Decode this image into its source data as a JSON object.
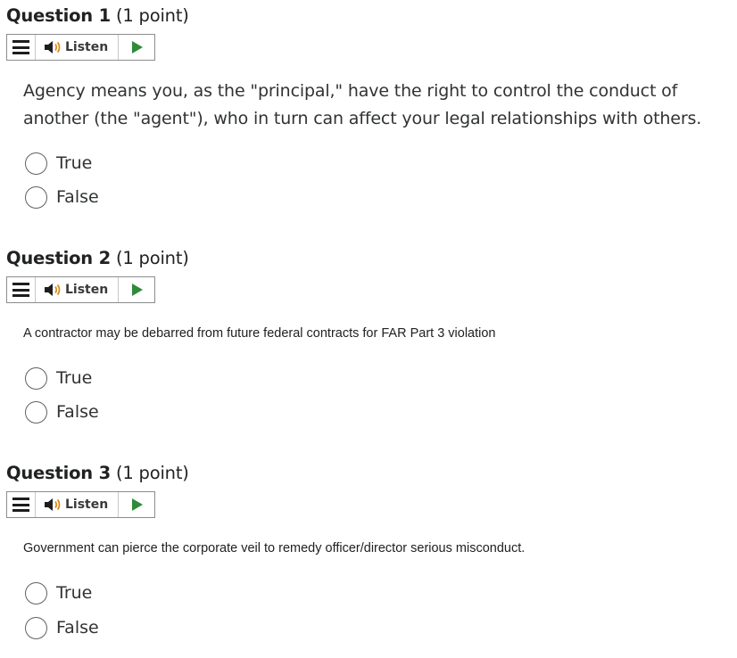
{
  "questions": [
    {
      "number": "Question 1",
      "points": "(1 point)",
      "listen": {
        "label": "Listen"
      },
      "text": "Agency means you, as the \"principal,\" have the right to control the conduct of another (the \"agent\"), who in turn can affect your legal relationships with others.",
      "options": [
        "True",
        "False"
      ]
    },
    {
      "number": "Question 2",
      "points": "(1 point)",
      "listen": {
        "label": "Listen"
      },
      "text": "A contractor may be debarred from future federal contracts for FAR Part 3 violation",
      "options": [
        "True",
        "False"
      ]
    },
    {
      "number": "Question 3",
      "points": "(1 point)",
      "listen": {
        "label": "Listen"
      },
      "text": "Government can pierce the corporate veil to remedy officer/director serious misconduct.",
      "options": [
        "True",
        "False"
      ]
    }
  ],
  "icons": {
    "menu": "hamburger-menu-icon",
    "speaker": "speaker-icon",
    "play": "play-icon"
  },
  "colors": {
    "play": "#2e8b3a",
    "text": "#202122",
    "border": "#8a8c8e"
  }
}
